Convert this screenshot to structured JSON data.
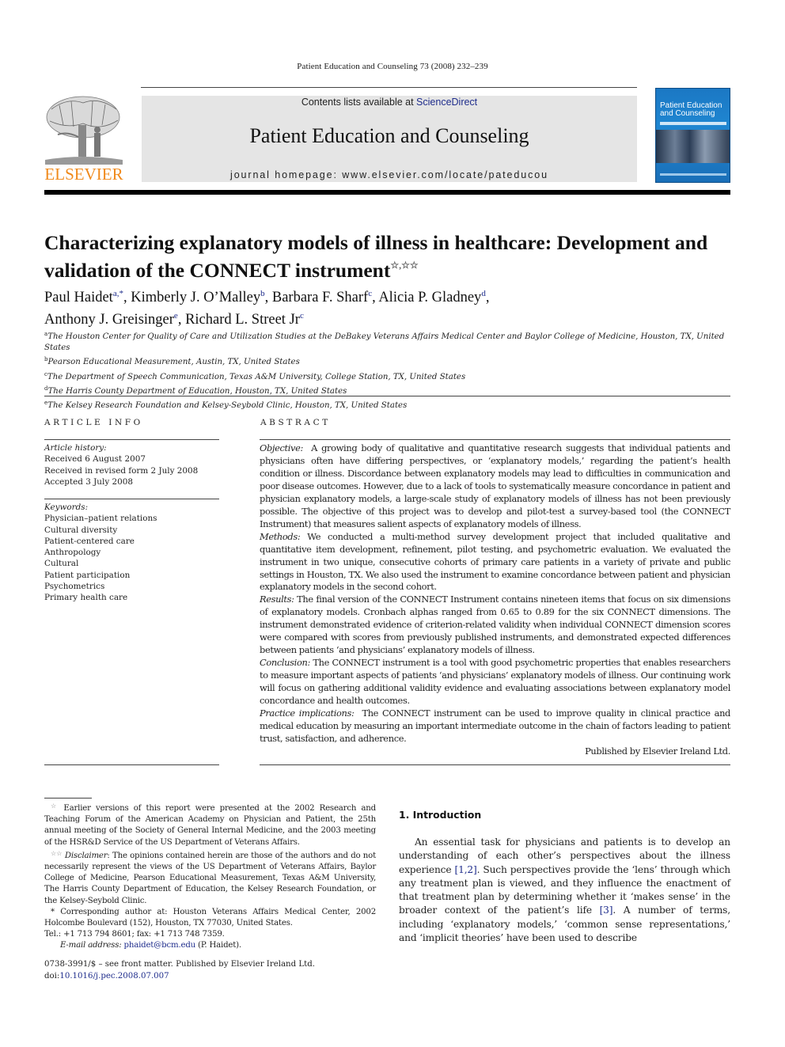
{
  "running_head": "Patient Education and Counseling 73 (2008) 232–239",
  "masthead": {
    "contents_prefix": "Contents lists available at ",
    "contents_link": "ScienceDirect",
    "journal_title": "Patient Education and Counseling",
    "homepage": "journal homepage: www.elsevier.com/locate/pateducou",
    "publisher_logo_text": "ELSEVIER",
    "cover_title_line1": "Patient Education",
    "cover_title_line2": "and Counseling"
  },
  "article": {
    "title": "Characterizing explanatory models of illness in healthcare: Development and validation of the CONNECT instrument",
    "title_marks": "☆,☆☆",
    "authors": [
      {
        "name": "Paul Haidet",
        "sup": "a,*",
        "sep": ", "
      },
      {
        "name": "Kimberly J. O’Malley",
        "sup": "b",
        "sep": ", "
      },
      {
        "name": "Barbara F. Sharf",
        "sup": "c",
        "sep": ", "
      },
      {
        "name": "Alicia P. Gladney",
        "sup": "d",
        "sep": ","
      },
      {
        "name": "Anthony J. Greisinger",
        "sup": "e",
        "sep": ", "
      },
      {
        "name": "Richard L. Street Jr",
        "sup": "c",
        "sep": ""
      }
    ],
    "affiliations": [
      {
        "key": "a",
        "text": "The Houston Center for Quality of Care and Utilization Studies at the DeBakey Veterans Affairs Medical Center and Baylor College of Medicine, Houston, TX, United States"
      },
      {
        "key": "b",
        "text": "Pearson Educational Measurement, Austin, TX, United States"
      },
      {
        "key": "c",
        "text": "The Department of Speech Communication, Texas A&M University, College Station, TX, United States"
      },
      {
        "key": "d",
        "text": "The Harris County Department of Education, Houston, TX, United States"
      },
      {
        "key": "e",
        "text": "The Kelsey Research Foundation and Kelsey-Seybold Clinic, Houston, TX, United States"
      }
    ]
  },
  "article_info": {
    "heading": "ARTICLE INFO",
    "history_label": "Article history:",
    "history": [
      "Received 6 August 2007",
      "Received in revised form 2 July 2008",
      "Accepted 3 July 2008"
    ],
    "keywords_label": "Keywords:",
    "keywords": [
      "Physician–patient relations",
      "Cultural diversity",
      "Patient-centered care",
      "Anthropology",
      "Cultural",
      "Patient participation",
      "Psychometrics",
      "Primary health care"
    ]
  },
  "abstract": {
    "heading": "ABSTRACT",
    "sections": [
      {
        "label": "Objective:",
        "text": "A growing body of qualitative and quantitative research suggests that individual patients and physicians often have differing perspectives, or ‘explanatory models,’ regarding the patient’s health condition or illness. Discordance between explanatory models may lead to difficulties in communication and poor disease outcomes. However, due to a lack of tools to systematically measure concordance in patient and physician explanatory models, a large-scale study of explanatory models of illness has not been previously possible. The objective of this project was to develop and pilot-test a survey-based tool (the CONNECT Instrument) that measures salient aspects of explanatory models of illness."
      },
      {
        "label": "Methods:",
        "text": "We conducted a multi-method survey development project that included qualitative and quantitative item development, refinement, pilot testing, and psychometric evaluation. We evaluated the instrument in two unique, consecutive cohorts of primary care patients in a variety of private and public settings in Houston, TX. We also used the instrument to examine concordance between patient and physician explanatory models in the second cohort."
      },
      {
        "label": "Results:",
        "text": "The final version of the CONNECT Instrument contains nineteen items that focus on six dimensions of explanatory models. Cronbach alphas ranged from 0.65 to 0.89 for the six CONNECT dimensions. The instrument demonstrated evidence of criterion-related validity when individual CONNECT dimension scores were compared with scores from previously published instruments, and demonstrated expected differences between patients ‘and physicians’ explanatory models of illness."
      },
      {
        "label": "Conclusion:",
        "text": "The CONNECT instrument is a tool with good psychometric properties that enables researchers to measure important aspects of patients ‘and physicians’ explanatory models of illness. Our continuing work will focus on gathering additional validity evidence and evaluating associations between explanatory model concordance and health outcomes."
      },
      {
        "label": "Practice implications:",
        "text": "The CONNECT instrument can be used to improve quality in clinical practice and medical education by measuring an important intermediate outcome in the chain of factors leading to patient trust, satisfaction, and adherence."
      }
    ],
    "published_by": "Published by Elsevier Ireland Ltd."
  },
  "footnotes": {
    "fn1_mark": "☆",
    "fn1": "Earlier versions of this report were presented at the 2002 Research and Teaching Forum of the American Academy on Physician and Patient, the 25th annual meeting of the Society of General Internal Medicine, and the 2003 meeting of the HSR&D Service of the US Department of Veterans Affairs.",
    "fn2_mark": "☆☆",
    "fn2_label": "Disclaimer",
    "fn2": ": The opinions contained herein are those of the authors and do not necessarily represent the views of the US Department of Veterans Affairs, Baylor College of Medicine, Pearson Educational Measurement, Texas A&M University, The Harris County Department of Education, the Kelsey Research Foundation, or the Kelsey-Seybold Clinic.",
    "corresponding": "* Corresponding author at: Houston Veterans Affairs Medical Center, 2002 Holcombe Boulevard (152), Houston, TX 77030, United States.",
    "tel": "Tel.: +1 713 794 8601; fax: +1 713 748 7359.",
    "email_label": "E-mail address:",
    "email": "phaidet@bcm.edu",
    "email_suffix": " (P. Haidet)."
  },
  "issn": {
    "line1": "0738-3991/$ – see front matter. Published by Elsevier Ireland Ltd.",
    "doi_prefix": "doi:",
    "doi": "10.1016/j.pec.2008.07.007"
  },
  "introduction": {
    "heading": "1.  Introduction",
    "p1_a": "An essential task for physicians and patients is to develop an understanding of each other’s perspectives about the illness experience ",
    "cite1": "[1,2]",
    "p1_b": ". Such perspectives provide the ‘lens’ through which any treatment plan is viewed, and they influence the enactment of that treatment plan by determining whether it ‘makes sense’ in the broader context of the patient’s life ",
    "cite2": "[3]",
    "p1_c": ". A number of terms, including ‘explanatory models,’ ‘common sense representations,’ and ‘implicit theories’ have been used to describe"
  }
}
